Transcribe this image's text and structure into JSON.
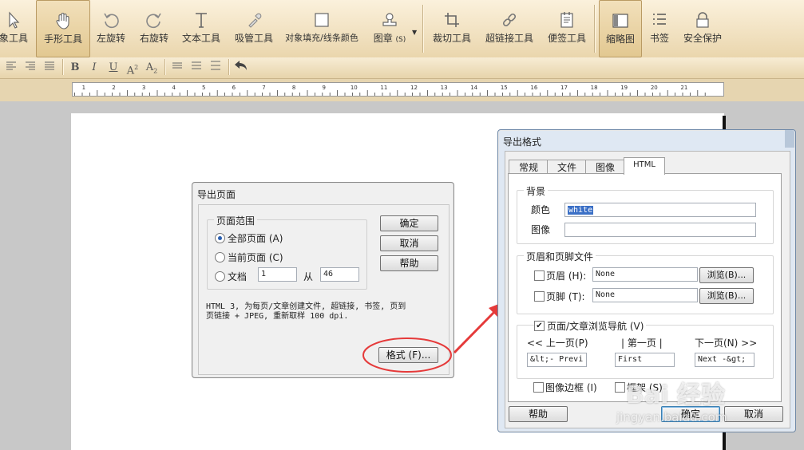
{
  "toolbar": {
    "buttons": [
      {
        "label": "象工具",
        "icon": "pointer-icon"
      },
      {
        "label": "手形工具",
        "icon": "hand-icon"
      },
      {
        "label": "左旋转",
        "icon": "rotate-left-icon"
      },
      {
        "label": "右旋转",
        "icon": "rotate-right-icon"
      },
      {
        "label": "文本工具",
        "icon": "text-icon"
      },
      {
        "label": "吸管工具",
        "icon": "eyedropper-icon"
      },
      {
        "label": "对象填充/线条颜色",
        "icon": "fill-icon"
      },
      {
        "label": "图章",
        "sub": "(S)",
        "icon": "stamp-icon"
      },
      {
        "label": "裁切工具",
        "icon": "crop-icon"
      },
      {
        "label": "超链接工具",
        "icon": "link-icon"
      },
      {
        "label": "便签工具",
        "icon": "note-icon"
      },
      {
        "label": "缩略图",
        "icon": "thumbnail-icon"
      },
      {
        "label": "书签",
        "icon": "bookmark-icon"
      },
      {
        "label": "安全保护",
        "icon": "lock-icon"
      }
    ]
  },
  "ruler": {
    "ticks": [
      "1",
      "2",
      "3",
      "4",
      "5",
      "6",
      "7",
      "8",
      "9",
      "10",
      "11",
      "12",
      "13",
      "14",
      "15",
      "16",
      "17",
      "18",
      "19",
      "20",
      "21"
    ]
  },
  "export_dialog": {
    "title": "导出页面",
    "range_group": "页面范围",
    "all_pages": "全部页面 (A)",
    "current_page": "当前页面 (C)",
    "document": "文档",
    "doc_from": "1",
    "from_label": "从",
    "doc_to": "46",
    "ok": "确定",
    "cancel": "取消",
    "help": "帮助",
    "description_1": "HTML 3, 为每页/文章创建文件, 超链接, 书签, 页到",
    "description_2": "页链接 + JPEG, 重新取样 100 dpi.",
    "format_button": "格式 (F)..."
  },
  "format_dialog": {
    "title": "导出格式",
    "tabs": [
      "常规",
      "文件",
      "图像",
      "HTML"
    ],
    "background_group": "背景",
    "color_label": "颜色",
    "color_value": "white",
    "image_label": "图像",
    "image_value": "",
    "header_footer_group": "页眉和页脚文件",
    "header_label": "页眉 (H):",
    "header_value": "None",
    "footer_label": "页脚 (T):",
    "footer_value": "None",
    "browse_1": "浏览(B)...",
    "browse_2": "浏览(B)...",
    "nav_group": "页面/文章浏览导航 (V)",
    "prev_label": "<< 上一页(P)",
    "first_label": "| 第一页 |",
    "next_label": "下一页(N) >>",
    "prev_value": "&lt;- Previ",
    "first_value": "First",
    "next_value": "Next -&gt;",
    "image_border": "图像边框 (I)",
    "frame": "框架 (S)",
    "help": "帮助",
    "ok": "确定",
    "cancel": "取消"
  },
  "watermark": {
    "brand": "Bai 经验",
    "url": "jingyan.baidu.com"
  },
  "colors": {
    "annotation_red": "#e53a3a",
    "toolbar_bg": "#efdfbb"
  }
}
